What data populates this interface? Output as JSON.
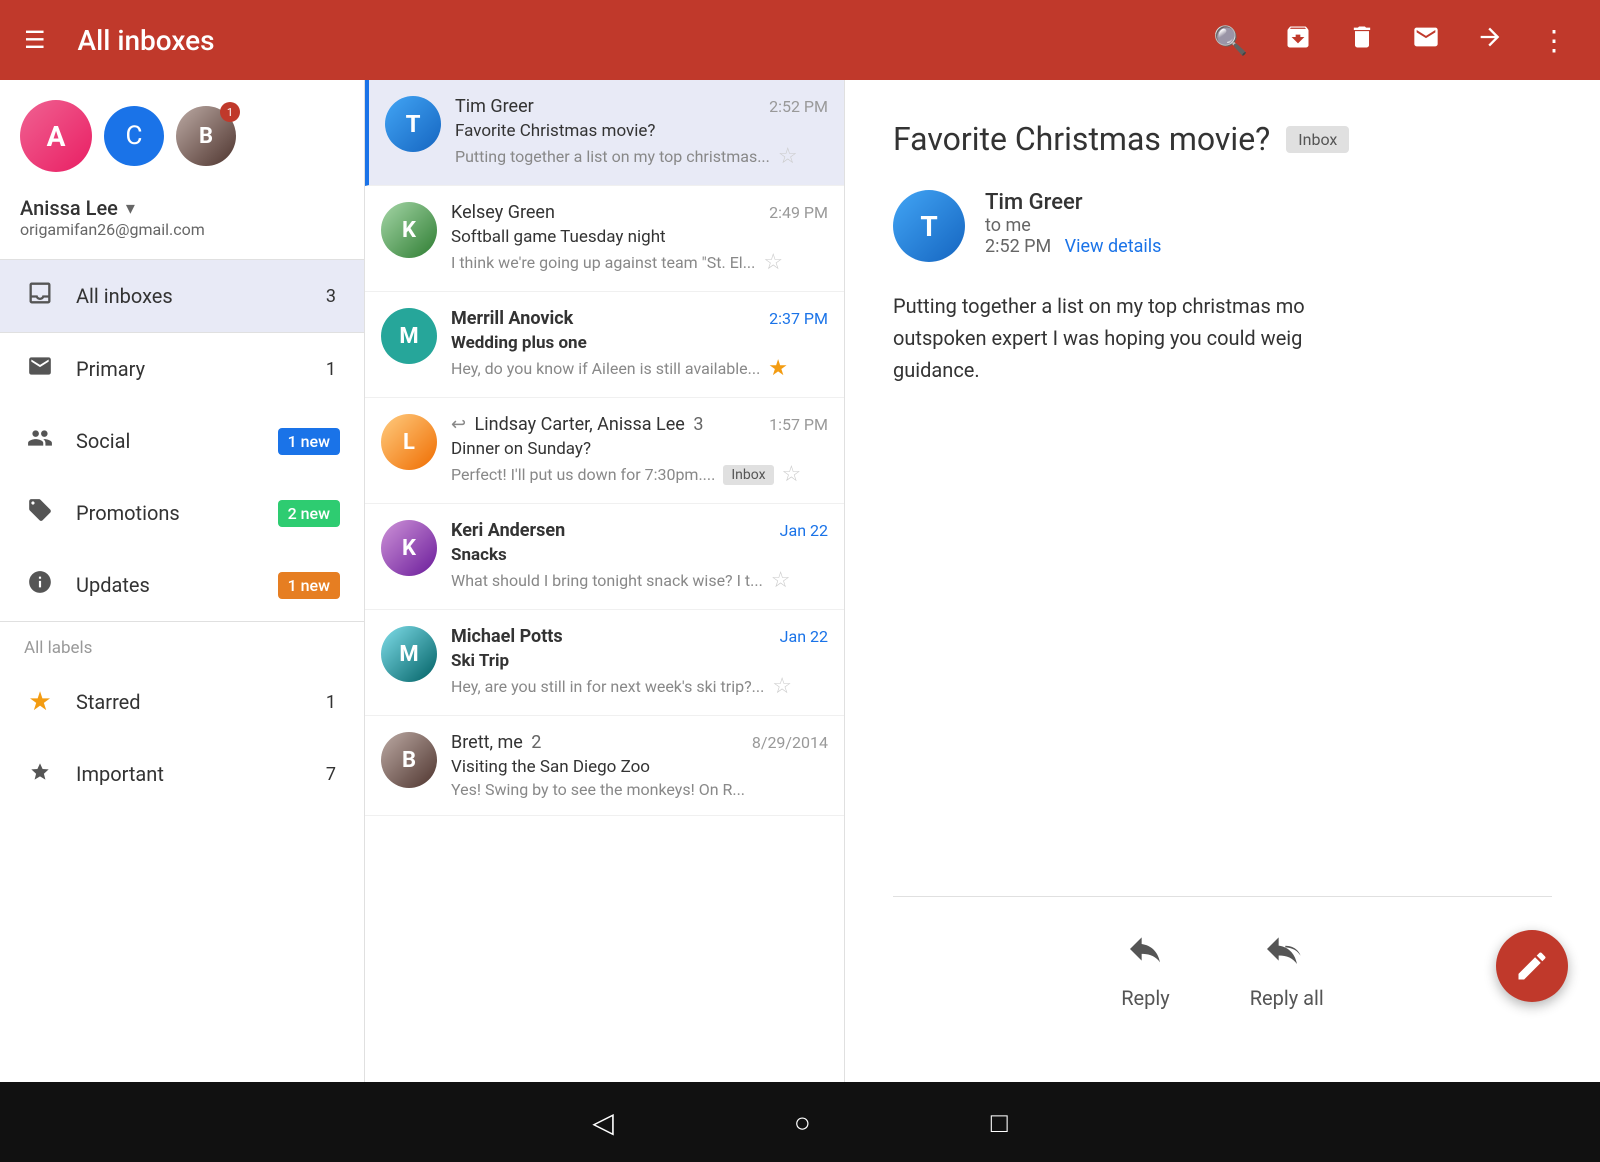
{
  "topbar": {
    "hamburger": "☰",
    "title": "All inboxes",
    "search_icon": "🔍",
    "archive_icon": "⬇",
    "delete_icon": "🗑",
    "mail_icon": "✉",
    "forward_icon": "➡",
    "more_icon": "⋮"
  },
  "sidebar": {
    "accounts": [
      {
        "initials": "A",
        "display": "face",
        "name": "Anissa"
      },
      {
        "initials": "C",
        "display": "letter"
      },
      {
        "initials": "B",
        "display": "face",
        "badge": "1"
      }
    ],
    "user_name": "Anissa Lee",
    "user_email": "origamifan26@gmail.com",
    "nav_items": [
      {
        "icon": "▤",
        "label": "All inboxes",
        "count": "3",
        "count_type": "number",
        "active": true
      },
      {
        "icon": "□",
        "label": "Primary",
        "count": "1",
        "count_type": "number",
        "active": false
      },
      {
        "icon": "👥",
        "label": "Social",
        "count": "1 new",
        "count_type": "badge_blue",
        "active": false
      },
      {
        "icon": "🏷",
        "label": "Promotions",
        "count": "2 new",
        "count_type": "badge_green",
        "active": false
      },
      {
        "icon": "ℹ",
        "label": "Updates",
        "count": "1 new",
        "count_type": "badge_orange",
        "active": false
      }
    ],
    "all_labels": "All labels",
    "label_items": [
      {
        "icon": "★",
        "label": "Starred",
        "count": "1"
      },
      {
        "icon": "▶",
        "label": "Important",
        "count": "7"
      }
    ]
  },
  "email_list": {
    "emails": [
      {
        "id": 1,
        "sender": "Tim Greer",
        "avatar_letter": "T",
        "avatar_class": "face-tim",
        "time": "2:52 PM",
        "time_class": "normal",
        "subject": "Favorite Christmas movie?",
        "preview": "Putting together a list on my top christmas...",
        "star": false,
        "bold": false,
        "selected": true,
        "inbox_badge": false,
        "reply_icon": false,
        "count": null
      },
      {
        "id": 2,
        "sender": "Kelsey Green",
        "avatar_letter": "K",
        "avatar_class": "face-kelsey",
        "time": "2:49 PM",
        "time_class": "normal",
        "subject": "Softball game Tuesday night",
        "preview": "I think we're going up against team \"St. El...",
        "star": false,
        "bold": false,
        "selected": false,
        "inbox_badge": false,
        "reply_icon": false,
        "count": null
      },
      {
        "id": 3,
        "sender": "Merrill Anovick",
        "avatar_letter": "M",
        "avatar_class": "face-merrill",
        "time": "2:37 PM",
        "time_class": "blue",
        "subject": "Wedding plus one",
        "preview": "Hey, do you know if Aileen is still available...",
        "star": true,
        "bold": true,
        "selected": false,
        "inbox_badge": false,
        "reply_icon": false,
        "count": null
      },
      {
        "id": 4,
        "sender": "Lindsay Carter, Anissa Lee",
        "avatar_letter": "L",
        "avatar_class": "face-lindsay",
        "time": "1:57 PM",
        "time_class": "normal",
        "subject": "Dinner on Sunday?",
        "preview": "Perfect! I'll put us down for 7:30pm....",
        "star": false,
        "bold": false,
        "selected": false,
        "inbox_badge": true,
        "reply_icon": true,
        "count": "3"
      },
      {
        "id": 5,
        "sender": "Keri Andersen",
        "avatar_letter": "K",
        "avatar_class": "face-keri",
        "time": "Jan 22",
        "time_class": "blue",
        "subject": "Snacks",
        "preview": "What should I bring tonight snack wise? I t...",
        "star": false,
        "bold": true,
        "selected": false,
        "inbox_badge": false,
        "reply_icon": false,
        "count": null
      },
      {
        "id": 6,
        "sender": "Michael Potts",
        "avatar_letter": "M",
        "avatar_class": "face-michael",
        "time": "Jan 22",
        "time_class": "blue",
        "subject": "Ski Trip",
        "preview": "Hey, are you still in for next week's ski trip?...",
        "star": false,
        "bold": true,
        "selected": false,
        "inbox_badge": false,
        "reply_icon": false,
        "count": null
      },
      {
        "id": 7,
        "sender": "Brett, me",
        "avatar_letter": "B",
        "avatar_class": "face-brett",
        "time": "8/29/2014",
        "time_class": "normal",
        "subject": "Visiting the San Diego Zoo",
        "preview": "Yes! Swing by to see the monkeys! On R...",
        "star": false,
        "bold": false,
        "selected": false,
        "inbox_badge": false,
        "reply_icon": false,
        "count": "2"
      }
    ]
  },
  "email_detail": {
    "subject": "Favorite Christmas movie?",
    "inbox_label": "Inbox",
    "sender_name": "Tim Greer",
    "sender_to": "to me",
    "sender_time": "2:52 PM",
    "view_details": "View details",
    "body": "Putting together a list on my top christmas mo\noutspoken expert I was hoping you could weig\nguidance.",
    "reply_label": "Reply",
    "reply_all_label": "Reply all",
    "reply_icon": "↩",
    "reply_all_icon": "↩↩"
  },
  "bottom_bar": {
    "back_icon": "◁",
    "home_icon": "○",
    "recent_icon": "□"
  }
}
